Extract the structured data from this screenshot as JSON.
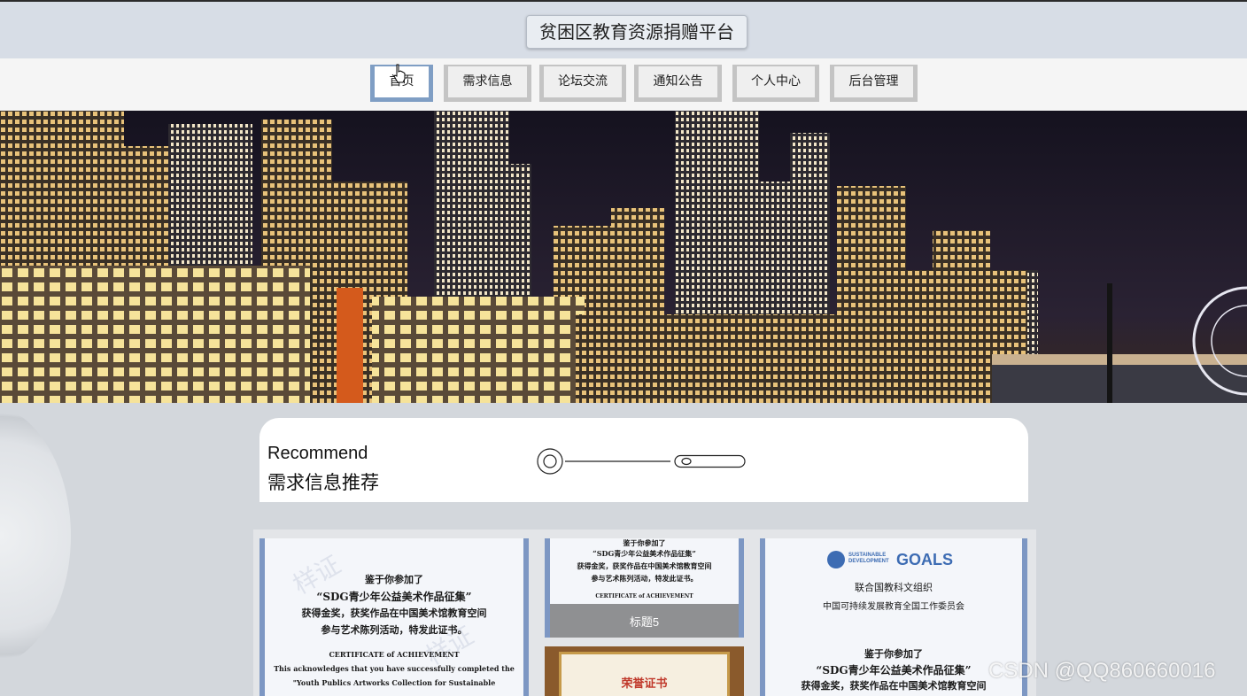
{
  "header": {
    "title": "贫困区教育资源捐赠平台"
  },
  "nav": {
    "items": [
      {
        "label": "首页"
      },
      {
        "label": "需求信息"
      },
      {
        "label": "论坛交流"
      },
      {
        "label": "通知公告"
      },
      {
        "label": "个人中心"
      },
      {
        "label": "后台管理"
      }
    ],
    "active_index": 0
  },
  "banner": {
    "slide_count": 3,
    "active_slide": 0
  },
  "recommend": {
    "title_en": "Recommend",
    "title_zh": "需求信息推荐"
  },
  "cards": {
    "left": {
      "lines": [
        "鉴于你参加了",
        "“SDG青少年公益美术作品征集”",
        "获得金奖，获奖作品在中国美术馆教育空间",
        "参与艺术陈列活动，特发此证书。",
        "CERTIFICATE of ACHIEVEMENT",
        "This acknowledges that you have successfully completed the",
        "\"Youth Publics Artworks Collection for Sustainable"
      ],
      "watermark": "样证"
    },
    "middle_top": {
      "lines": [
        "鉴于你参加了",
        "“SDG青少年公益美术作品征集”",
        "获得金奖，获奖作品在中国美术馆教育空间",
        "参与艺术陈列活动，特发此证书。",
        "CERTIFICATE of ACHIEVEMENT"
      ],
      "caption": "标题5"
    },
    "middle_bottom": {
      "text": "荣誉证书"
    },
    "right": {
      "logo_small": "SUSTAINABLE DEVELOPMENT",
      "logo_big": "GOALS",
      "lines": [
        "联合国教科文组织",
        "中国可持续发展教育全国工作委员会",
        "鉴于你参加了",
        "“SDG青少年公益美术作品征集”",
        "获得金奖，获奖作品在中国美术馆教育空间"
      ]
    }
  },
  "watermark": "CSDN @QQ860660016",
  "colors": {
    "nav_active_border": "#7f9ec4",
    "nav_border": "#c4c4c4",
    "dot_active": "#3a6fb5"
  }
}
